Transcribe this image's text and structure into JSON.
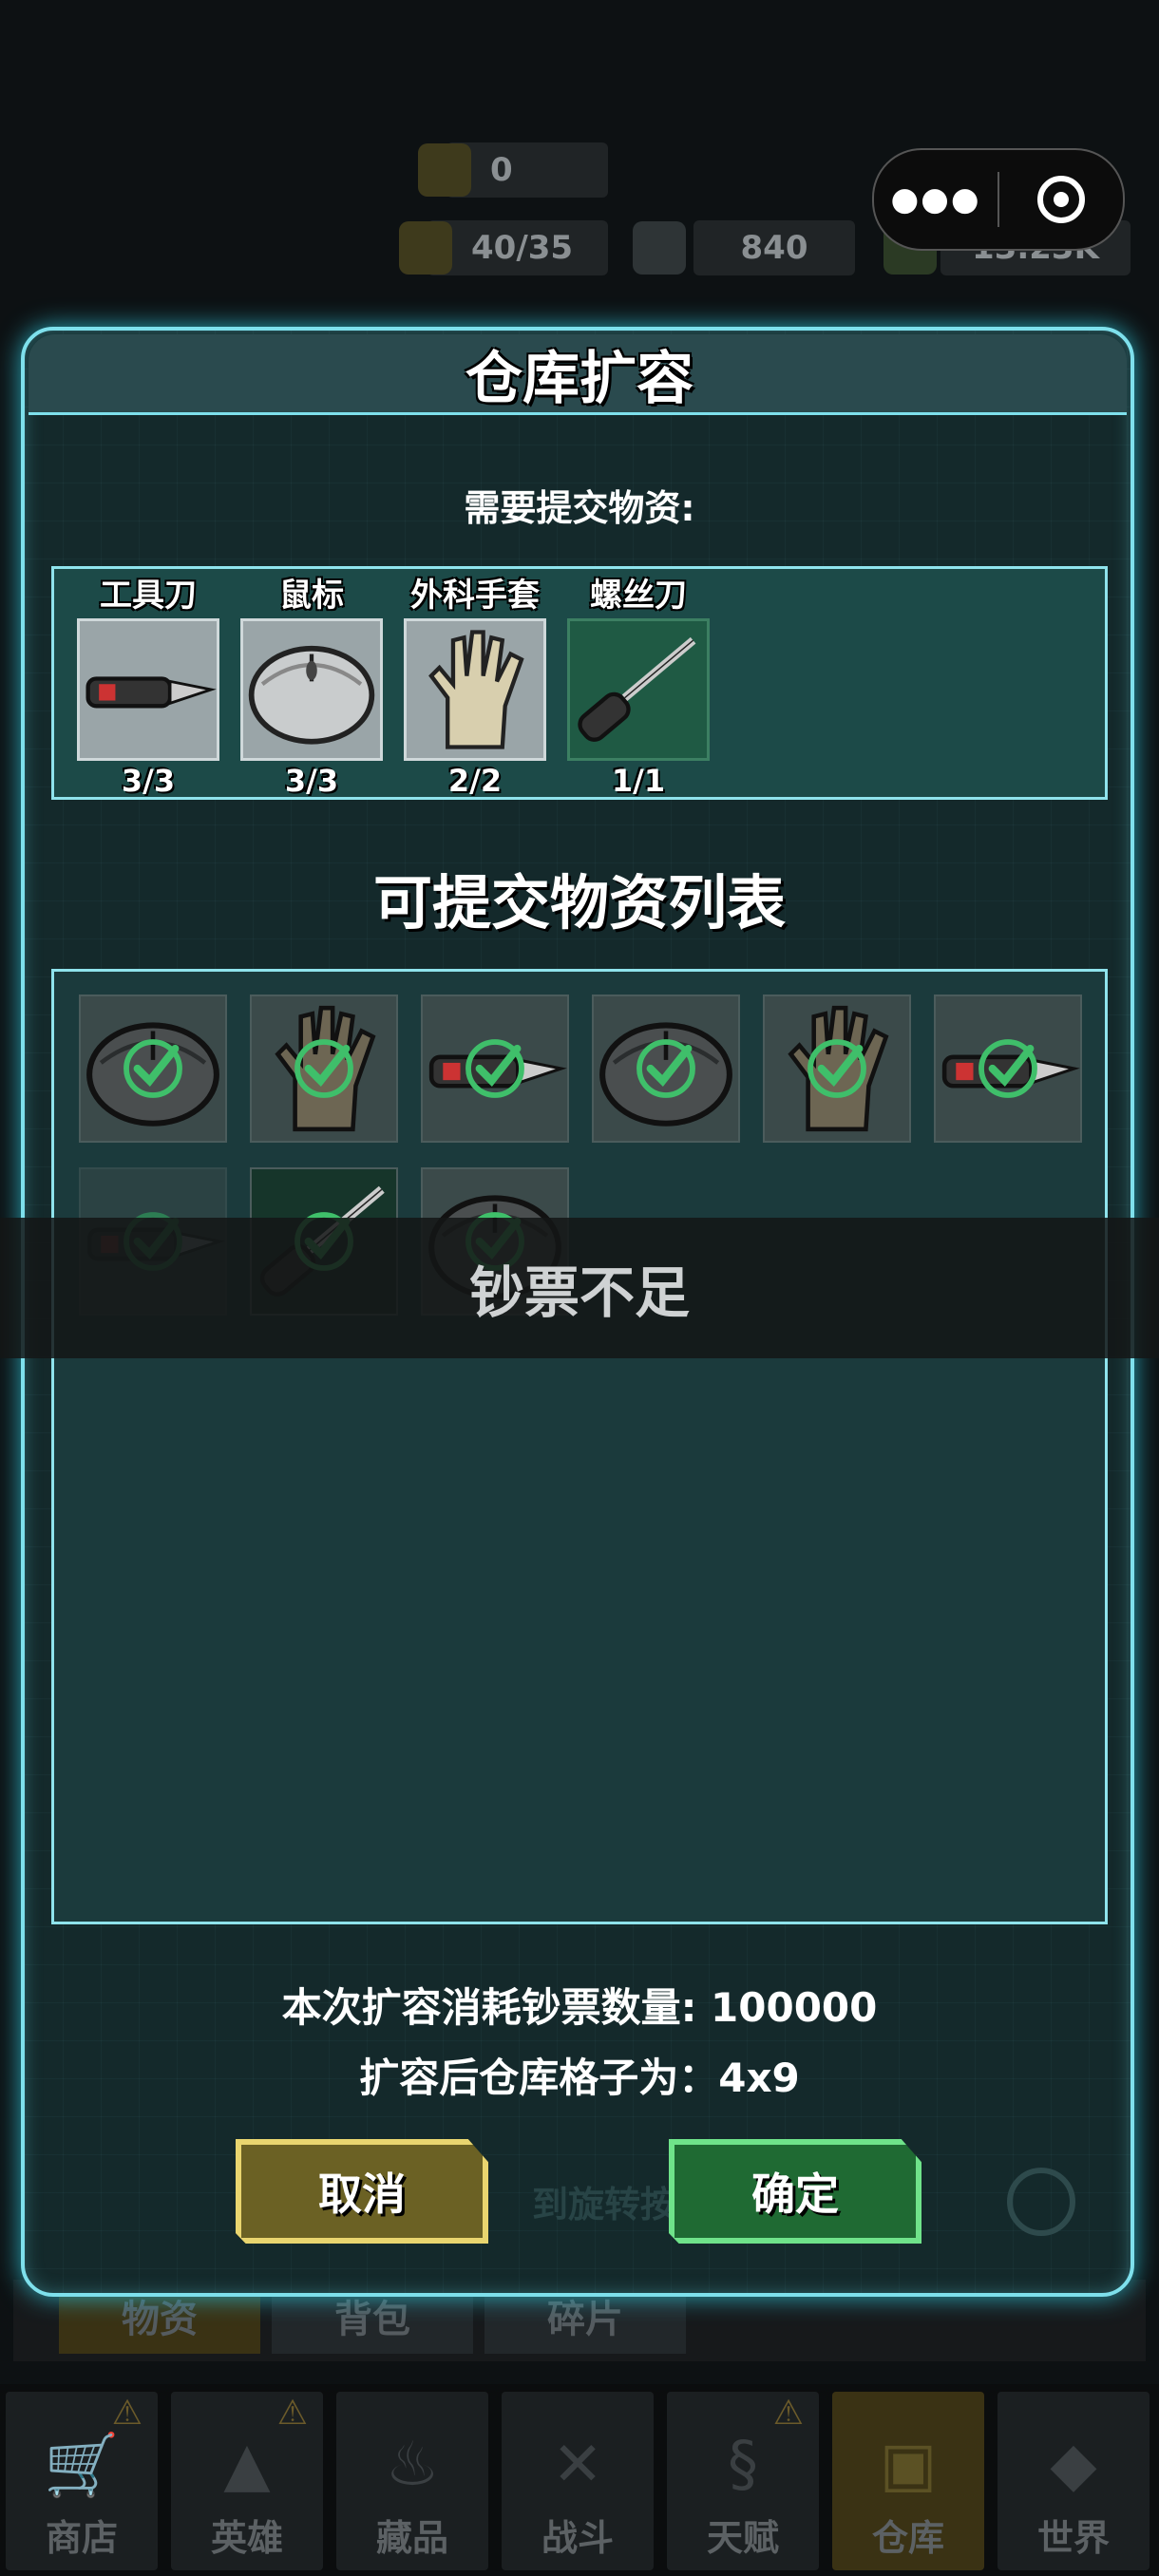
{
  "background": {
    "resources": {
      "energy": "0",
      "stamina": "40/35",
      "diamond": "840",
      "cash": "13.23K"
    },
    "tabs": [
      "物资",
      "背包",
      "碎片"
    ],
    "hint_text": "到旋转按钮"
  },
  "dialog": {
    "title": "仓库扩容",
    "need_label": "需要提交物资:",
    "required_items": [
      {
        "name": "工具刀",
        "count": "3/3",
        "icon": "utility-knife-icon"
      },
      {
        "name": "鼠标",
        "count": "3/3",
        "icon": "mouse-icon"
      },
      {
        "name": "外科手套",
        "count": "2/2",
        "icon": "glove-icon"
      },
      {
        "name": "螺丝刀",
        "count": "1/1",
        "icon": "screwdriver-icon"
      }
    ],
    "list_title": "可提交物资列表",
    "inventory": [
      {
        "icon": "mouse-icon",
        "checked": true
      },
      {
        "icon": "glove-icon",
        "checked": true
      },
      {
        "icon": "utility-knife-icon",
        "checked": true
      },
      {
        "icon": "mouse-icon",
        "checked": true
      },
      {
        "icon": "glove-icon",
        "checked": true
      },
      {
        "icon": "utility-knife-icon",
        "checked": true
      },
      {
        "icon": "utility-knife-icon",
        "checked": true
      },
      {
        "icon": "screwdriver-icon",
        "checked": true
      },
      {
        "icon": "mouse-icon",
        "checked": true
      }
    ],
    "cost_text": "本次扩容消耗钞票数量: 100000",
    "after_text": "扩容后仓库格子为：4x9",
    "cancel_label": "取消",
    "confirm_label": "确定"
  },
  "toast": "钞票不足",
  "nav": [
    {
      "label": "商店",
      "warn": true
    },
    {
      "label": "英雄",
      "warn": true
    },
    {
      "label": "藏品",
      "warn": false
    },
    {
      "label": "战斗",
      "warn": false
    },
    {
      "label": "天赋",
      "warn": true
    },
    {
      "label": "仓库",
      "warn": false
    },
    {
      "label": "世界",
      "warn": false
    }
  ],
  "colors": {
    "accent": "#7ee0ec",
    "panel": "#14292b",
    "cancel": "#e9d56f",
    "confirm": "#6fe38a"
  }
}
